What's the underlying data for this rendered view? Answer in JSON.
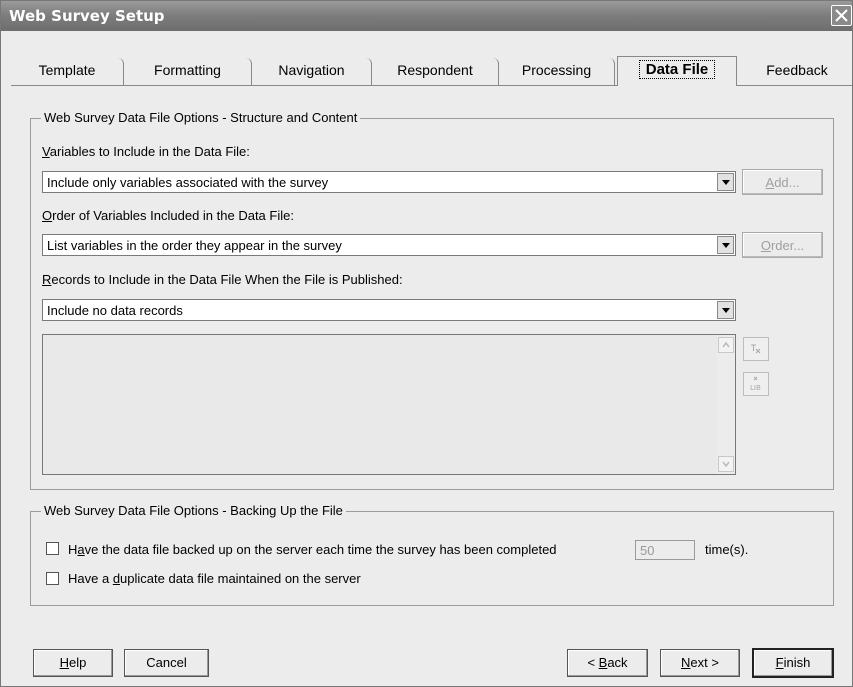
{
  "window": {
    "title": "Web Survey Setup"
  },
  "tabs": [
    {
      "label": "Template"
    },
    {
      "label": "Formatting"
    },
    {
      "label": "Navigation"
    },
    {
      "label": "Respondent"
    },
    {
      "label": "Processing"
    },
    {
      "label": "Data File",
      "active": true
    },
    {
      "label": "Feedback"
    }
  ],
  "structure_group": {
    "title": "Web Survey Data File Options - Structure and Content",
    "variables": {
      "label_u": "V",
      "label_rest": "ariables to Include in the Data File:",
      "selected": "Include only variables associated with the survey",
      "button_u": "A",
      "button_rest": "dd..."
    },
    "order": {
      "label_u": "O",
      "label_rest": "rder of Variables Included in the Data File:",
      "selected": "List variables in the order they appear in the survey",
      "button_u": "O",
      "button_rest": "rder..."
    },
    "records": {
      "label_u": "R",
      "label_rest": "ecords to Include in the Data File When the File is Published:",
      "selected": "Include no data records"
    }
  },
  "backup_group": {
    "title": "Web Survey Data File Options - Backing Up the File",
    "backup_check": {
      "label_pre": "H",
      "label_u": "a",
      "label_rest": "ve the data file backed up on the server each time the survey has been completed",
      "count": "50",
      "suffix": "time(s).",
      "checked": false
    },
    "duplicate_check": {
      "label_pre": "Have a ",
      "label_u": "d",
      "label_rest": "uplicate data file maintained on the server",
      "checked": false
    }
  },
  "footer": {
    "help_u": "H",
    "help_rest": "elp",
    "cancel": "Cancel",
    "back_pre": "< ",
    "back_u": "B",
    "back_rest": "ack",
    "next_u": "N",
    "next_rest": "ext >",
    "finish_u": "F",
    "finish_rest": "inish"
  }
}
